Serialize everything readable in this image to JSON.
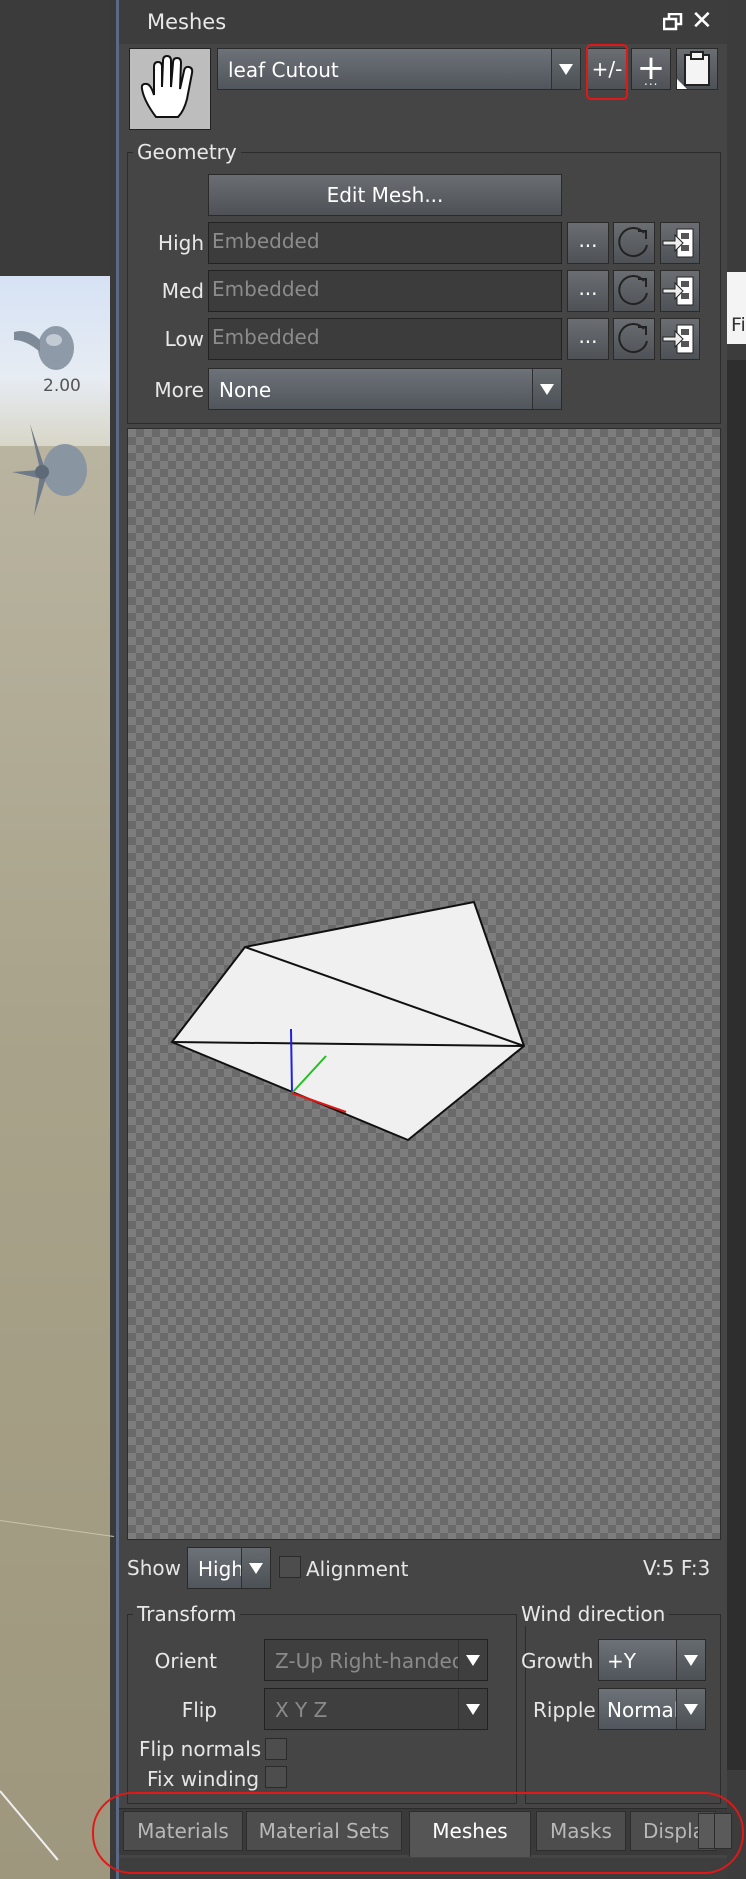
{
  "viewport": {
    "bulb_label": "2.00"
  },
  "right_fragment": {
    "text": "Fi"
  },
  "panel": {
    "title": "Meshes",
    "mesh_select": "leaf Cutout",
    "plusminus_label": "+/-",
    "plus_label": "+",
    "plus_sub": "...",
    "geometry": {
      "label": "Geometry",
      "edit_mesh": "Edit Mesh...",
      "rows": [
        {
          "label": "High",
          "placeholder": "Embedded",
          "dots": "..."
        },
        {
          "label": "Med",
          "placeholder": "Embedded",
          "dots": "..."
        },
        {
          "label": "Low",
          "placeholder": "Embedded",
          "dots": "..."
        }
      ],
      "more_label": "More",
      "more_value": "None"
    },
    "show_label": "Show",
    "show_value": "High",
    "alignment_label": "Alignment",
    "stats": "V:5  F:3",
    "transform": {
      "label": "Transform",
      "orient_label": "Orient",
      "orient_value": "Z-Up Right-handed",
      "flip_label": "Flip",
      "flip_value": "X Y Z",
      "flip_normals_label": "Flip normals",
      "fix_winding_label": "Fix winding"
    },
    "wind": {
      "label": "Wind direction",
      "growth_label": "Growth",
      "growth_value": "+Y",
      "ripple_label": "Ripple",
      "ripple_value": "Normal"
    },
    "tabs": [
      "Materials",
      "Material Sets",
      "Meshes",
      "Masks",
      "Displac"
    ],
    "active_tab": "Meshes"
  },
  "colors": {
    "highlight": "#e01818",
    "panel_bg": "#454545",
    "axis_x": "#e01818",
    "axis_y": "#20c020",
    "axis_z": "#2020e0"
  }
}
